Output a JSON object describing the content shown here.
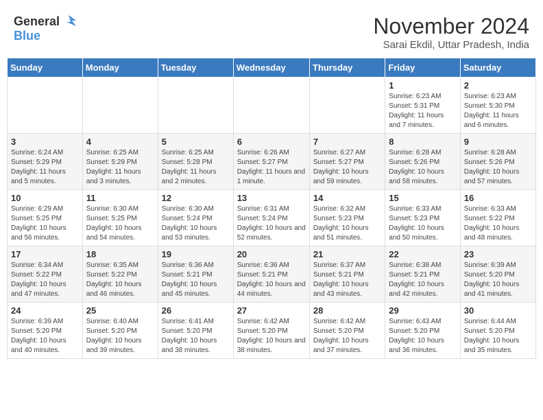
{
  "header": {
    "logo_general": "General",
    "logo_blue": "Blue",
    "month_year": "November 2024",
    "location": "Sarai Ekdil, Uttar Pradesh, India"
  },
  "weekdays": [
    "Sunday",
    "Monday",
    "Tuesday",
    "Wednesday",
    "Thursday",
    "Friday",
    "Saturday"
  ],
  "weeks": [
    [
      {
        "day": "",
        "info": ""
      },
      {
        "day": "",
        "info": ""
      },
      {
        "day": "",
        "info": ""
      },
      {
        "day": "",
        "info": ""
      },
      {
        "day": "",
        "info": ""
      },
      {
        "day": "1",
        "info": "Sunrise: 6:23 AM\nSunset: 5:31 PM\nDaylight: 11 hours and 7 minutes."
      },
      {
        "day": "2",
        "info": "Sunrise: 6:23 AM\nSunset: 5:30 PM\nDaylight: 11 hours and 6 minutes."
      }
    ],
    [
      {
        "day": "3",
        "info": "Sunrise: 6:24 AM\nSunset: 5:29 PM\nDaylight: 11 hours and 5 minutes."
      },
      {
        "day": "4",
        "info": "Sunrise: 6:25 AM\nSunset: 5:29 PM\nDaylight: 11 hours and 3 minutes."
      },
      {
        "day": "5",
        "info": "Sunrise: 6:25 AM\nSunset: 5:28 PM\nDaylight: 11 hours and 2 minutes."
      },
      {
        "day": "6",
        "info": "Sunrise: 6:26 AM\nSunset: 5:27 PM\nDaylight: 11 hours and 1 minute."
      },
      {
        "day": "7",
        "info": "Sunrise: 6:27 AM\nSunset: 5:27 PM\nDaylight: 10 hours and 59 minutes."
      },
      {
        "day": "8",
        "info": "Sunrise: 6:28 AM\nSunset: 5:26 PM\nDaylight: 10 hours and 58 minutes."
      },
      {
        "day": "9",
        "info": "Sunrise: 6:28 AM\nSunset: 5:26 PM\nDaylight: 10 hours and 57 minutes."
      }
    ],
    [
      {
        "day": "10",
        "info": "Sunrise: 6:29 AM\nSunset: 5:25 PM\nDaylight: 10 hours and 56 minutes."
      },
      {
        "day": "11",
        "info": "Sunrise: 6:30 AM\nSunset: 5:25 PM\nDaylight: 10 hours and 54 minutes."
      },
      {
        "day": "12",
        "info": "Sunrise: 6:30 AM\nSunset: 5:24 PM\nDaylight: 10 hours and 53 minutes."
      },
      {
        "day": "13",
        "info": "Sunrise: 6:31 AM\nSunset: 5:24 PM\nDaylight: 10 hours and 52 minutes."
      },
      {
        "day": "14",
        "info": "Sunrise: 6:32 AM\nSunset: 5:23 PM\nDaylight: 10 hours and 51 minutes."
      },
      {
        "day": "15",
        "info": "Sunrise: 6:33 AM\nSunset: 5:23 PM\nDaylight: 10 hours and 50 minutes."
      },
      {
        "day": "16",
        "info": "Sunrise: 6:33 AM\nSunset: 5:22 PM\nDaylight: 10 hours and 48 minutes."
      }
    ],
    [
      {
        "day": "17",
        "info": "Sunrise: 6:34 AM\nSunset: 5:22 PM\nDaylight: 10 hours and 47 minutes."
      },
      {
        "day": "18",
        "info": "Sunrise: 6:35 AM\nSunset: 5:22 PM\nDaylight: 10 hours and 46 minutes."
      },
      {
        "day": "19",
        "info": "Sunrise: 6:36 AM\nSunset: 5:21 PM\nDaylight: 10 hours and 45 minutes."
      },
      {
        "day": "20",
        "info": "Sunrise: 6:36 AM\nSunset: 5:21 PM\nDaylight: 10 hours and 44 minutes."
      },
      {
        "day": "21",
        "info": "Sunrise: 6:37 AM\nSunset: 5:21 PM\nDaylight: 10 hours and 43 minutes."
      },
      {
        "day": "22",
        "info": "Sunrise: 6:38 AM\nSunset: 5:21 PM\nDaylight: 10 hours and 42 minutes."
      },
      {
        "day": "23",
        "info": "Sunrise: 6:39 AM\nSunset: 5:20 PM\nDaylight: 10 hours and 41 minutes."
      }
    ],
    [
      {
        "day": "24",
        "info": "Sunrise: 6:39 AM\nSunset: 5:20 PM\nDaylight: 10 hours and 40 minutes."
      },
      {
        "day": "25",
        "info": "Sunrise: 6:40 AM\nSunset: 5:20 PM\nDaylight: 10 hours and 39 minutes."
      },
      {
        "day": "26",
        "info": "Sunrise: 6:41 AM\nSunset: 5:20 PM\nDaylight: 10 hours and 38 minutes."
      },
      {
        "day": "27",
        "info": "Sunrise: 6:42 AM\nSunset: 5:20 PM\nDaylight: 10 hours and 38 minutes."
      },
      {
        "day": "28",
        "info": "Sunrise: 6:42 AM\nSunset: 5:20 PM\nDaylight: 10 hours and 37 minutes."
      },
      {
        "day": "29",
        "info": "Sunrise: 6:43 AM\nSunset: 5:20 PM\nDaylight: 10 hours and 36 minutes."
      },
      {
        "day": "30",
        "info": "Sunrise: 6:44 AM\nSunset: 5:20 PM\nDaylight: 10 hours and 35 minutes."
      }
    ]
  ]
}
